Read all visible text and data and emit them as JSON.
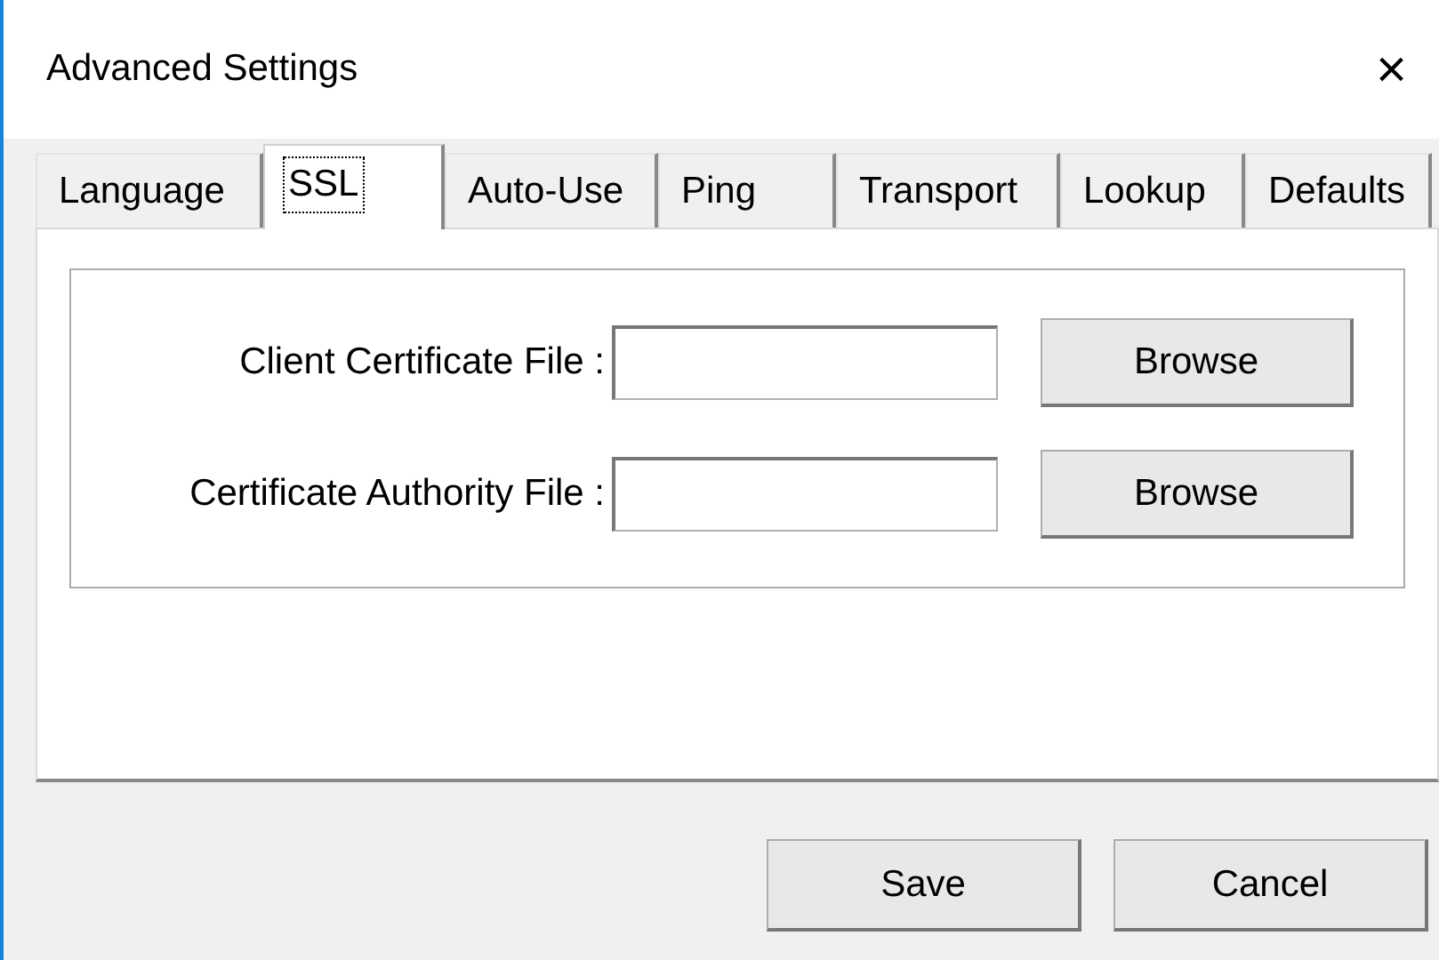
{
  "window": {
    "title": "Advanced Settings",
    "close": "×"
  },
  "tabs": [
    {
      "label": "Language",
      "selected": false
    },
    {
      "label": "SSL",
      "selected": true
    },
    {
      "label": "Auto-Use",
      "selected": false
    },
    {
      "label": "Ping",
      "selected": false
    },
    {
      "label": "Transport",
      "selected": false
    },
    {
      "label": "Lookup",
      "selected": false
    },
    {
      "label": "Defaults",
      "selected": false
    }
  ],
  "fields": [
    {
      "label": "Client Certificate File :",
      "button": "Browse"
    },
    {
      "label": "Certificate Authority File :",
      "button": "Browse"
    }
  ],
  "buttons": [
    "Save",
    "Cancel"
  ]
}
